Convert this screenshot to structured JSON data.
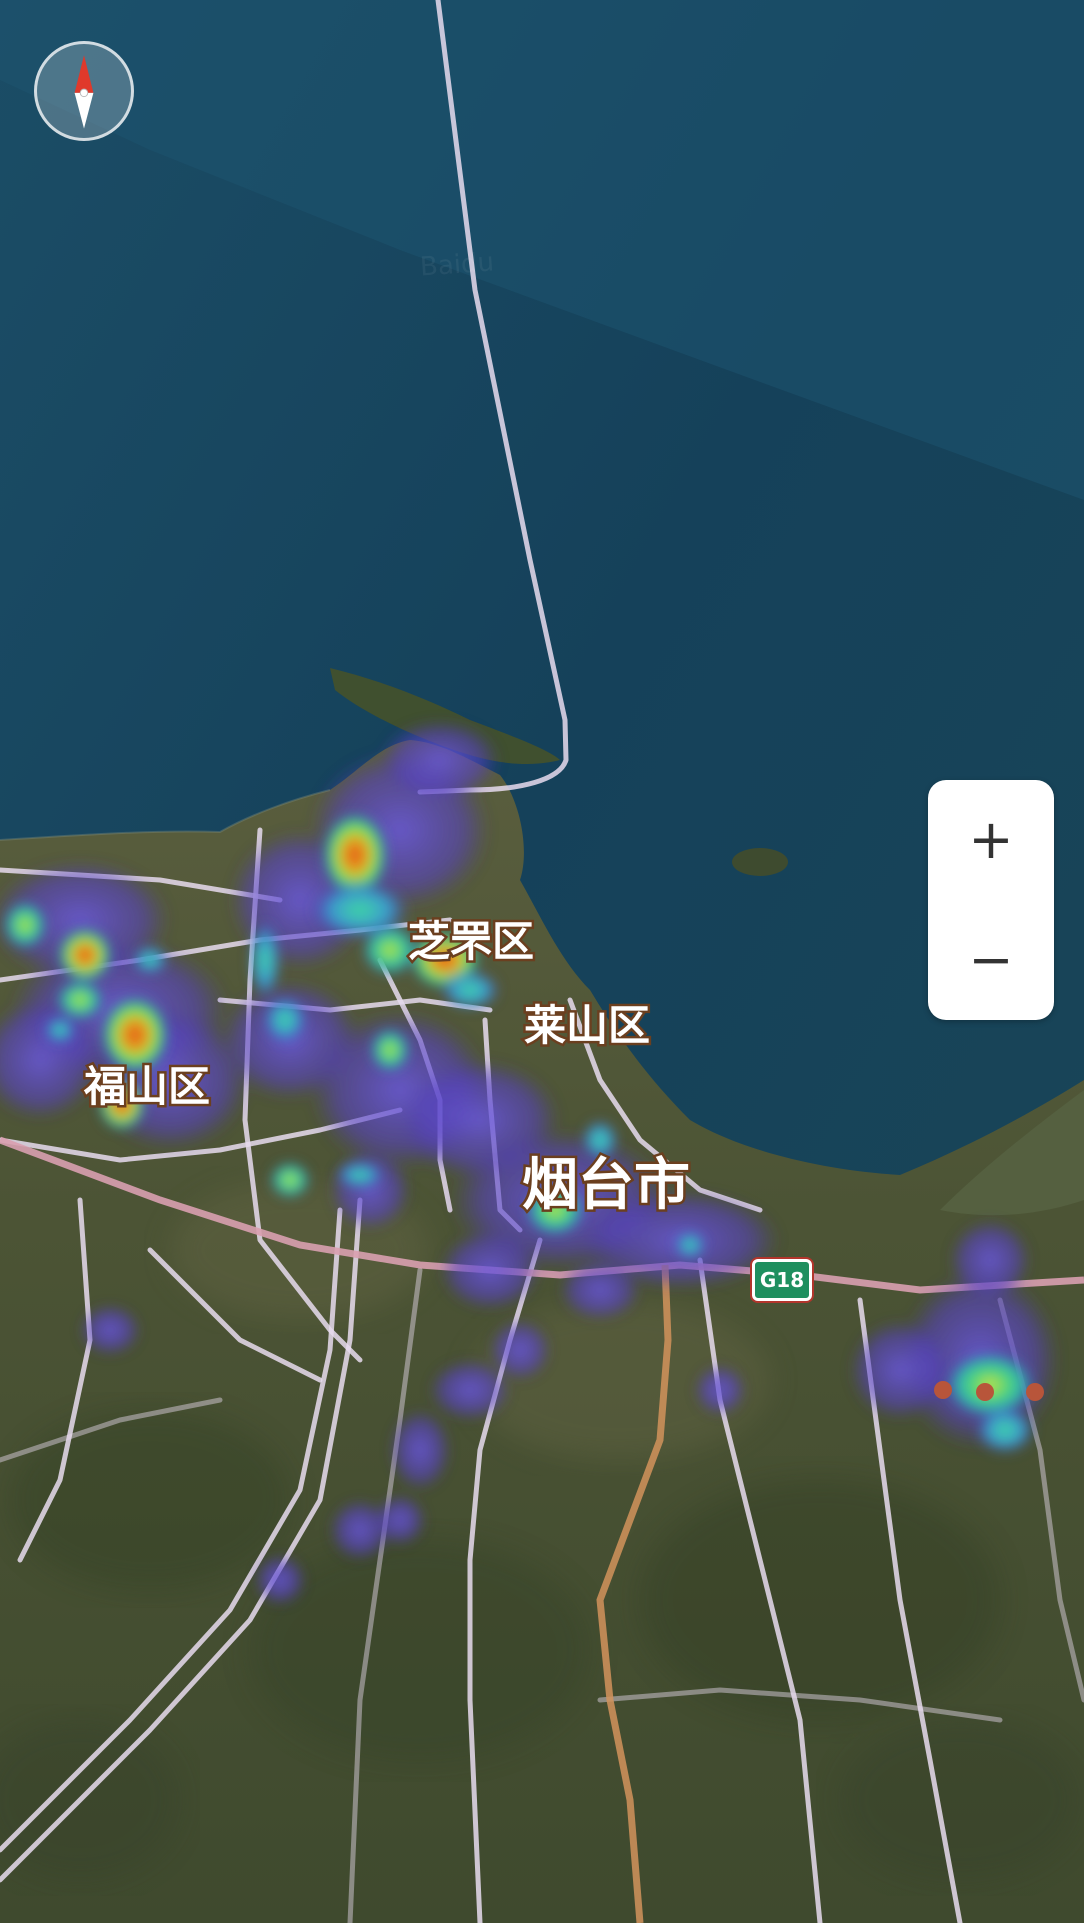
{
  "map": {
    "labels": {
      "zhifu": "芝罘区",
      "laishan": "莱山区",
      "fushan": "福山区",
      "yantai": "烟台市"
    },
    "road_shield": "G18",
    "watermark": "Baidu",
    "controls": {
      "zoom_in": "+",
      "zoom_out": "−"
    },
    "icons": {
      "compass": "compass-icon",
      "zoom_in": "plus-icon",
      "zoom_out": "minus-icon"
    },
    "colors": {
      "deep_sea": "#123a50",
      "shallow_sea": "#1c4a58",
      "land": "#4a5236",
      "heat_low": "#5a48c8",
      "heat_mid": "#2fd07a",
      "heat_high": "#e85a1e",
      "road_highway": "#d9a27a",
      "road_main": "#e8d8f0"
    }
  }
}
